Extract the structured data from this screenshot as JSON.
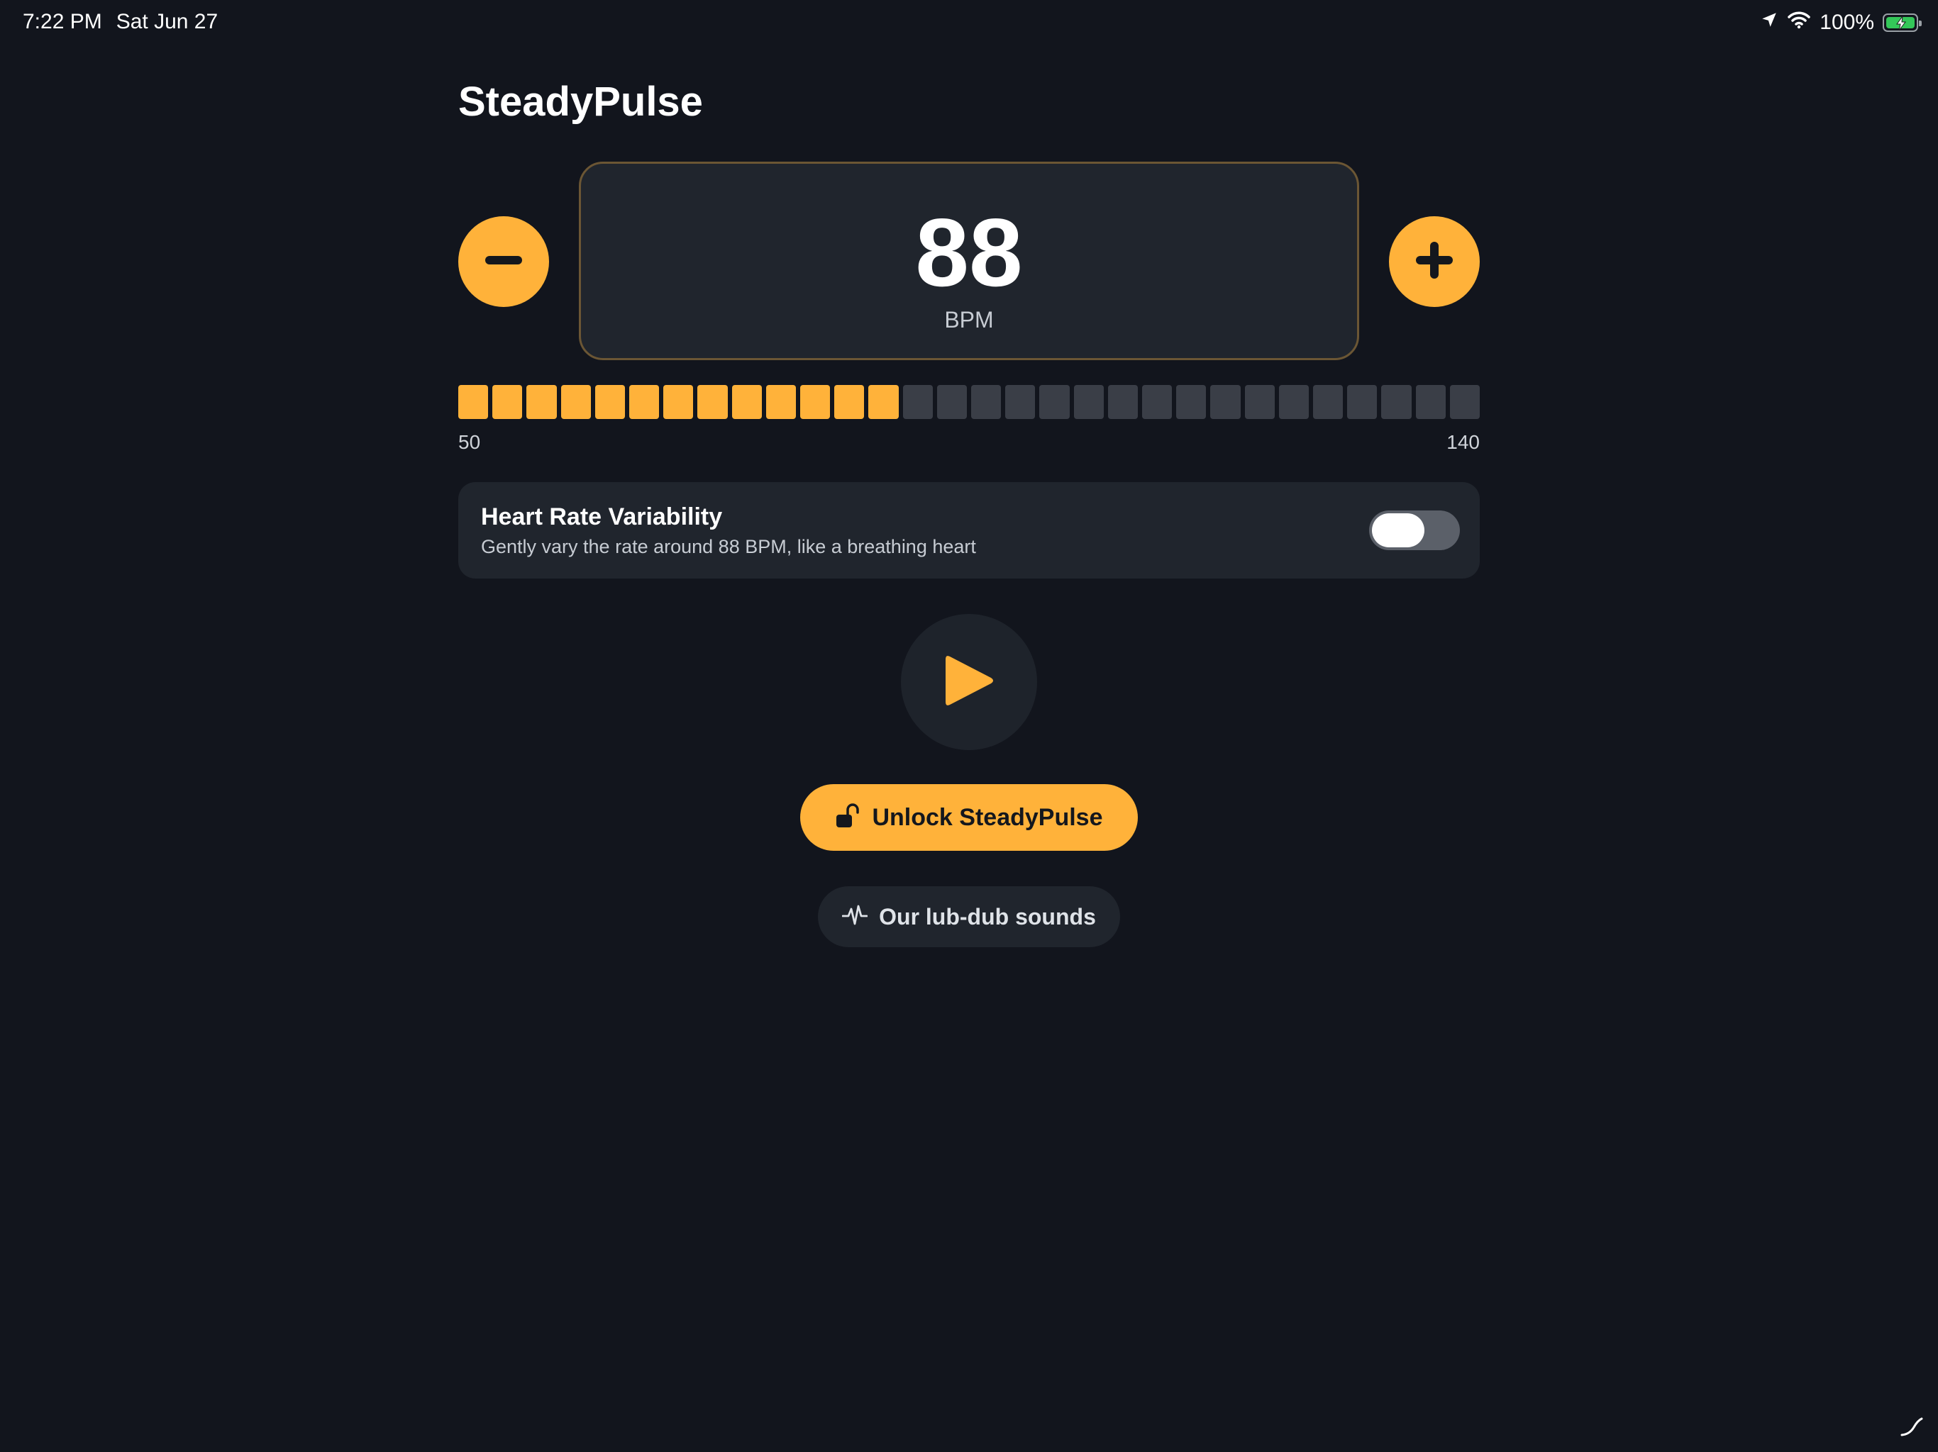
{
  "status_bar": {
    "time": "7:22 PM",
    "date": "Sat Jun 27",
    "battery_percent": "100%",
    "icons": [
      "location-arrow-icon",
      "wifi-icon",
      "battery-charging-icon"
    ]
  },
  "app": {
    "title": "SteadyPulse"
  },
  "tempo": {
    "value": "88",
    "unit": "BPM",
    "range_min": "50",
    "range_max": "140",
    "segments_total": 30,
    "segments_filled": 13,
    "decrement_icon": "minus-icon",
    "increment_icon": "plus-icon"
  },
  "hrv": {
    "title": "Heart Rate Variability",
    "subtitle": "Gently vary the rate around 88 BPM, like a breathing heart",
    "enabled": false
  },
  "playback": {
    "icon": "play-icon"
  },
  "unlock": {
    "label": "Unlock SteadyPulse",
    "icon": "unlock-icon"
  },
  "sounds": {
    "label": "Our lub-dub sounds",
    "icon": "heartbeat-wave-icon"
  },
  "colors": {
    "background": "#12151d",
    "accent": "#ffb23a",
    "card": "#20252d",
    "segment_off": "#3a3e47",
    "toggle_off": "#5b6069",
    "battery": "#34c759"
  }
}
